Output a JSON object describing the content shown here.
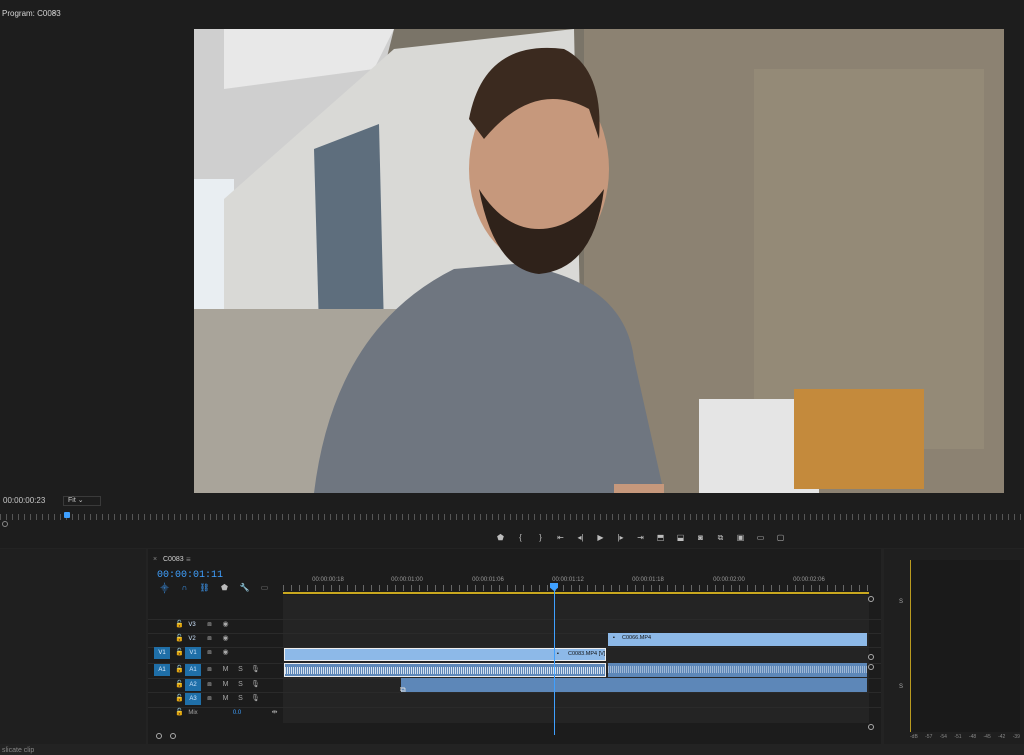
{
  "program_monitor": {
    "tab_label": "Program: C0083",
    "menu_icon": "hamburger-icon",
    "timecode": "00:00:00:23",
    "fit_label": "Fit",
    "transport_icons": [
      "marker-icon",
      "in-point-icon",
      "out-point-icon",
      "go-to-in-icon",
      "step-back-icon",
      "play-icon",
      "step-forward-icon",
      "go-to-out-icon",
      "lift-icon",
      "extract-icon",
      "export-frame-icon",
      "comparison-icon",
      "multicam-icon",
      "proxy-icon",
      "vr-icon"
    ]
  },
  "sequence": {
    "tab_label": "C0083",
    "close_label": "×",
    "menu_icon": "hamburger-icon",
    "timecode": "00:00:01:11",
    "ruler_labels": [
      "00:00:00:18",
      "00:00:01:00",
      "00:00:01:06",
      "00:00:01:12",
      "00:00:01:18",
      "00:00:02:00",
      "00:00:02:06"
    ],
    "tracks": {
      "video": [
        {
          "src": "",
          "label": "V3"
        },
        {
          "src": "",
          "label": "V2"
        },
        {
          "src": "V1",
          "label": "V1"
        }
      ],
      "audio": [
        {
          "src": "A1",
          "label": "A1",
          "m": "M",
          "s": "S"
        },
        {
          "src": "",
          "label": "A2",
          "m": "M",
          "s": "S"
        },
        {
          "src": "",
          "label": "A3",
          "m": "M",
          "s": "S"
        }
      ],
      "mix_label": "Mix",
      "mix_value": "0.0"
    },
    "clips": {
      "v2_clip_label": "C0066.MP4",
      "v1_clip_label": "C0083.MP4 [V]"
    }
  },
  "status_bar": {
    "text": "slicate clip"
  },
  "audio_meter": {
    "scale_labels": [
      "S",
      "S"
    ],
    "db_labels": [
      "-dB",
      "-57",
      "-54",
      "-51",
      "-48",
      "-45",
      "-42",
      "-39"
    ]
  },
  "colors": {
    "accent_blue": "#3fa0ff",
    "clip_video": "#8db9e8",
    "clip_audio": "#5d87b8",
    "work_area": "#c9a81f"
  }
}
